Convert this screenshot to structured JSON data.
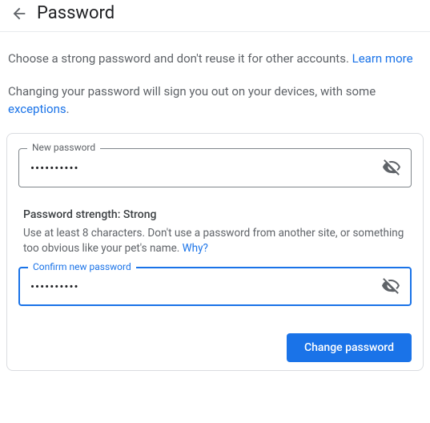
{
  "header": {
    "title": "Password"
  },
  "description": {
    "line1_pre": "Choose a strong password and don't reuse it for other accounts. ",
    "learn_more": "Learn more",
    "line2_pre": "Changing your password will sign you out on your devices, with some ",
    "exceptions": "exceptions",
    "line2_post": "."
  },
  "fields": {
    "new_password": {
      "label": "New password",
      "value": "••••••••••"
    },
    "confirm_password": {
      "label": "Confirm new password",
      "value": "••••••••••"
    }
  },
  "strength": {
    "title": "Password strength: Strong",
    "desc_pre": "Use at least 8 characters. Don't use a password from another site, or something too obvious like your pet's name. ",
    "why": "Why?"
  },
  "actions": {
    "change": "Change password"
  }
}
